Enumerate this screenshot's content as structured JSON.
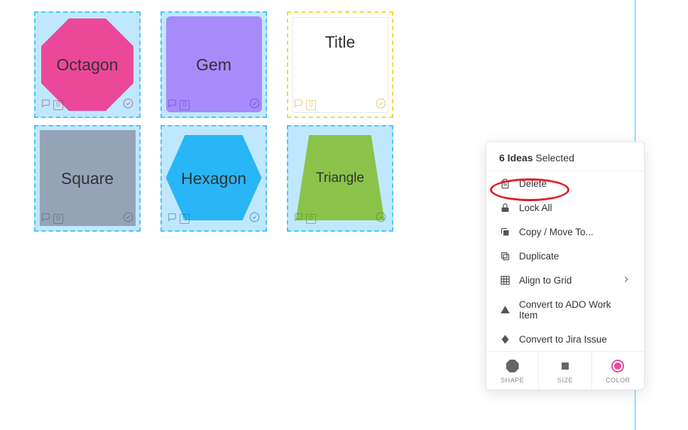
{
  "cards": [
    {
      "label": "Octagon",
      "footerColor": "pink",
      "shape": "octagon"
    },
    {
      "label": "Gem",
      "footerColor": "purple",
      "shape": "gem"
    },
    {
      "label": "Title",
      "footerColor": "yellow",
      "shape": "title"
    },
    {
      "label": "Square",
      "footerColor": "gray",
      "shape": "square"
    },
    {
      "label": "Hexagon",
      "footerColor": "blue",
      "shape": "hexagon"
    },
    {
      "label": "Triangle",
      "footerColor": "green",
      "shape": "triangle"
    }
  ],
  "panel": {
    "count": "6 Ideas",
    "selected": " Selected",
    "menu": {
      "delete": "Delete",
      "lock": "Lock All",
      "copy": "Copy / Move To...",
      "duplicate": "Duplicate",
      "align": "Align to Grid",
      "ado": "Convert to ADO Work Item",
      "jira": "Convert to Jira Issue"
    },
    "footer": {
      "shape": "SHAPE",
      "size": "SIZE",
      "color": "COLOR"
    }
  },
  "badge": "0"
}
